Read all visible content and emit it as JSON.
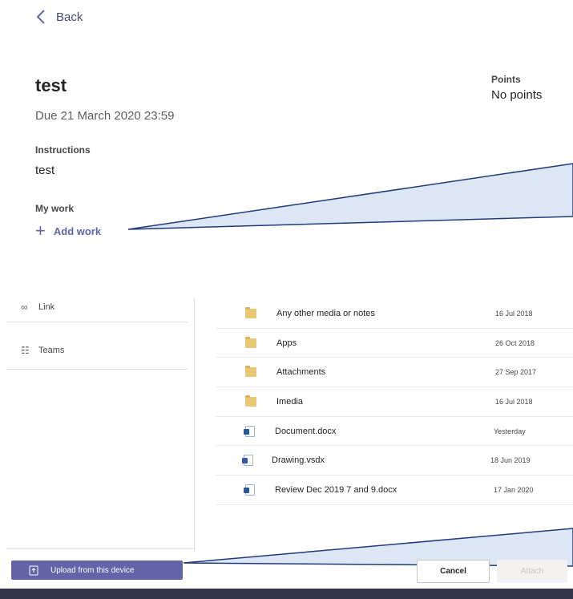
{
  "nav": {
    "back_label": "Back"
  },
  "assignment": {
    "title": "test",
    "due": "Due 21 March 2020 23:59",
    "points_label": "Points",
    "points_value": "No points",
    "instructions_label": "Instructions",
    "instructions_value": "test",
    "my_work_label": "My work",
    "add_work_label": "Add work"
  },
  "picker": {
    "sidebar": [
      {
        "label": "Link",
        "icon": "link-icon"
      },
      {
        "label": "Teams",
        "icon": "teams-icon"
      }
    ],
    "files": [
      {
        "name": "Any other media or notes",
        "date": "16 Jul 2018",
        "type": "folder"
      },
      {
        "name": "Apps",
        "date": "26 Oct 2018",
        "type": "folder"
      },
      {
        "name": "Attachments",
        "date": "27 Sep 2017",
        "type": "folder"
      },
      {
        "name": "Imedia",
        "date": "16 Jul 2018",
        "type": "folder"
      },
      {
        "name": "Document.docx",
        "date": "Yesterday",
        "type": "word"
      },
      {
        "name": "Drawing.vsdx",
        "date": "18 Jun 2019",
        "type": "visio"
      },
      {
        "name": "Review Dec 2019 7 and 9.docx",
        "date": "17 Jan 2020",
        "type": "word"
      }
    ],
    "upload_label": "Upload from this device",
    "cancel_label": "Cancel",
    "attach_label": "Attach"
  },
  "colors": {
    "accent": "#6264a7",
    "callout_fill": "#dce6f4",
    "callout_stroke": "#1f3b7a",
    "bottom_bar": "#33344a"
  }
}
